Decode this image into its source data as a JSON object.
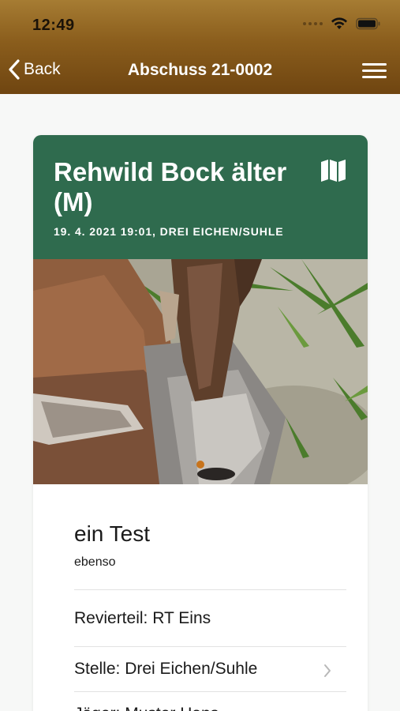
{
  "status_bar": {
    "time": "12:49"
  },
  "nav": {
    "back_label": "Back",
    "title": "Abschuss 21-0002"
  },
  "card": {
    "title": "Rehwild Bock älter (M)",
    "subtitle": "19. 4. 2021 19:01, DREI EICHEN/SUHLE",
    "header_color": "#2f6b4e",
    "photo_icon": "deer-photo"
  },
  "details": {
    "entry_title": "ein Test",
    "entry_description": "ebenso",
    "rows": [
      {
        "label": "Revierteil: RT Eins"
      },
      {
        "label": "Stelle: Drei Eichen/Suhle",
        "icon": "chevron-right-icon"
      },
      {
        "label": "Jäger: Muster Hans"
      }
    ]
  },
  "colors": {
    "header_top": "#a67c33",
    "header_bottom": "#6f4511",
    "accent_green": "#2f6b4e",
    "background": "#f7f8f7"
  }
}
